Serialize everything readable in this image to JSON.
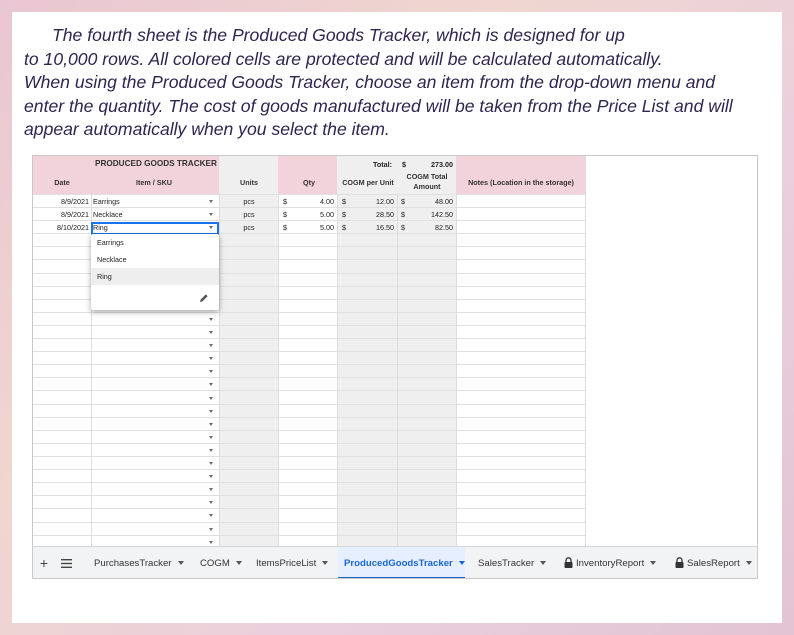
{
  "intro": {
    "line1": "The fourth sheet is the Produced Goods Tracker, which is designed for up",
    "line2": "to 10,000 rows. All colored cells are protected and will be calculated automatically.",
    "line3": "When using the Produced Goods Tracker, choose an item from the drop-down menu and",
    "line4": "enter the quantity. The cost of goods manufactured will be taken from the Price List and will",
    "line5": "appear automatically when you select the item."
  },
  "sheet": {
    "title": "PRODUCED GOODS TRACKER",
    "total_label": "Total:",
    "total_currency": "$",
    "total_value": "273.00",
    "headers": {
      "date": "Date",
      "item": "Item / SKU",
      "units": "Units",
      "qty": "Qty",
      "cogm_unit": "COGM per Unit",
      "cogm_total_1": "COGM Total",
      "cogm_total_2": "Amount",
      "notes": "Notes (Location in the storage)"
    },
    "rows": [
      {
        "date": "8/9/2021",
        "item": "Earrings",
        "units": "pcs",
        "cur1": "$",
        "qty": "4.00",
        "cur2": "$",
        "cogm": "12.00",
        "cur3": "$",
        "total": "48.00"
      },
      {
        "date": "8/9/2021",
        "item": "Necklace",
        "units": "pcs",
        "cur1": "$",
        "qty": "5.00",
        "cur2": "$",
        "cogm": "28.50",
        "cur3": "$",
        "total": "142.50"
      },
      {
        "date": "8/10/2021",
        "item": "Ring",
        "units": "pcs",
        "cur1": "$",
        "qty": "5.00",
        "cur2": "$",
        "cogm": "16.50",
        "cur3": "$",
        "total": "82.50"
      }
    ],
    "dropdown_options": [
      "Earrings",
      "Necklace",
      "Ring"
    ],
    "dropdown_highlighted": "Ring"
  },
  "tabs": {
    "add": "+",
    "items": [
      {
        "label": "PurchasesTracker",
        "locked": false,
        "active": false
      },
      {
        "label": "COGM",
        "locked": false,
        "active": false
      },
      {
        "label": "ItemsPriceList",
        "locked": false,
        "active": false
      },
      {
        "label": "ProducedGoodsTracker",
        "locked": false,
        "active": true
      },
      {
        "label": "SalesTracker",
        "locked": false,
        "active": false
      },
      {
        "label": "InventoryReport",
        "locked": true,
        "active": false
      },
      {
        "label": "SalesReport",
        "locked": true,
        "active": false
      }
    ]
  },
  "icons": {
    "add": "plus-icon",
    "menu": "all-sheets-menu-icon",
    "lock": "lock-icon",
    "pencil": "edit-pencil-icon",
    "caret": "chevron-down-icon"
  },
  "colors": {
    "header_pink": "#f2d3db",
    "shaded_col": "#efefef",
    "active_tab": "#1967d2",
    "selection": "#1a73e8",
    "intro_text": "#2f2550"
  }
}
